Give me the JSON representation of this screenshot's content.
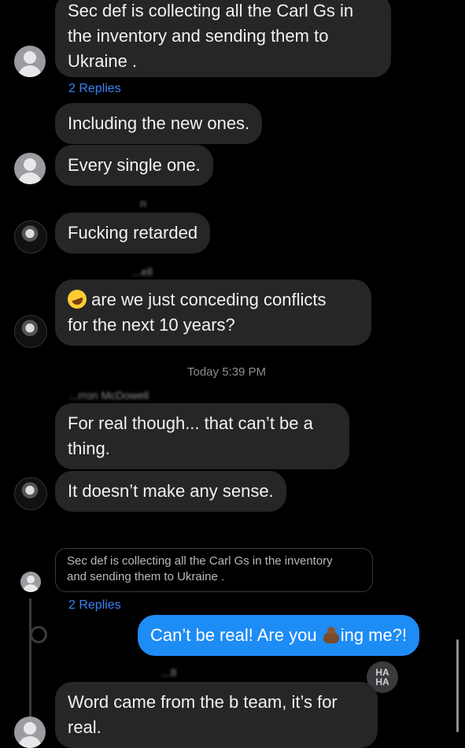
{
  "messages": {
    "m1": "Sec def is collecting all the Carl Gs in the inventory and sending them to Ukraine .",
    "m1_lines": [
      "Sec def is collecting all the Carl Gs in",
      "the inventory and sending them to",
      "Ukraine ."
    ],
    "m1_replies": "2 Replies",
    "m2": "Including the new ones.",
    "m3": "Every single one.",
    "m4_sender": "n",
    "m4": "Fucking retarded",
    "m5_sender": "...ell",
    "m5_line1": "are we just conceding conflicts",
    "m5_line2": "for the next 10 years?",
    "timestamp": "Today 5:39 PM",
    "m6_sender": "...rron McDowell",
    "m6_line1": "For real though... that can’t be a",
    "m6_line2": "thing.",
    "m7": "It doesn’t make any sense.",
    "quote_line1": "Sec def is collecting all the Carl Gs in the inventory",
    "quote_line2": "and sending them to Ukraine .",
    "thread_replies": "2 Replies",
    "out_pre": "Can’t be real! Are you",
    "out_post": "ing me?!",
    "m8_sender": "...8",
    "haha_top": "HA",
    "haha_bottom": "HA",
    "m8_line1": "Word came from the b team, it’s for",
    "m8_line2": "real."
  },
  "icons": {
    "avatar_default": "person-avatar-icon",
    "avatar_photo": "photo-avatar-icon",
    "emoji_laugh": "rolling-laughing-emoji-icon",
    "emoji_poop": "poop-emoji-icon",
    "reaction_haha": "haha-reaction-icon"
  },
  "colors": {
    "background": "#000000",
    "bubble_incoming": "#262628",
    "bubble_outgoing": "#1e8cf5",
    "link": "#3b82f6"
  }
}
